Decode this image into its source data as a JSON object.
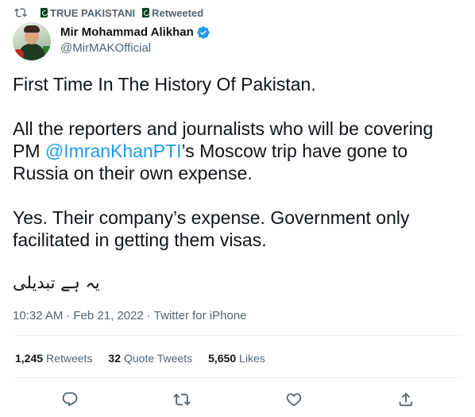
{
  "retweet_bar": {
    "source": "TRUE PAKISTANI",
    "label": "Retweeted",
    "icon": "retweet-icon"
  },
  "author": {
    "display_name": "Mir Mohammad Alikhan",
    "handle": "@MirMAKOfficial",
    "verified": true,
    "avatar_icon": "profile-photo"
  },
  "tweet": {
    "para1": "First Time In The History Of Pakistan.",
    "para2_before": "All the reporters and journalists who will be covering PM ",
    "para2_mention": "@ImranKhanPTI",
    "para2_after": "’s Moscow trip have gone to Russia on their own expense.",
    "para3": "Yes. Their company’s expense. Government only facilitated in getting them visas.",
    "para4": "یہ ہے تبدیلی"
  },
  "meta": {
    "time": "10:32 AM",
    "date": "Feb 21, 2022",
    "source": "Twitter for iPhone",
    "separator": "·"
  },
  "stats": {
    "retweets_count": "1,245",
    "retweets_label": "Retweets",
    "quotes_count": "32",
    "quotes_label": "Quote Tweets",
    "likes_count": "5,650",
    "likes_label": "Likes"
  },
  "actions": {
    "reply": "reply-icon",
    "retweet": "retweet-icon",
    "like": "like-icon",
    "share": "share-icon"
  },
  "colors": {
    "text": "#0f1419",
    "secondary": "#536471",
    "link": "#1d9bf0",
    "divider": "#eff3f4",
    "flag_green": "#01411c"
  }
}
